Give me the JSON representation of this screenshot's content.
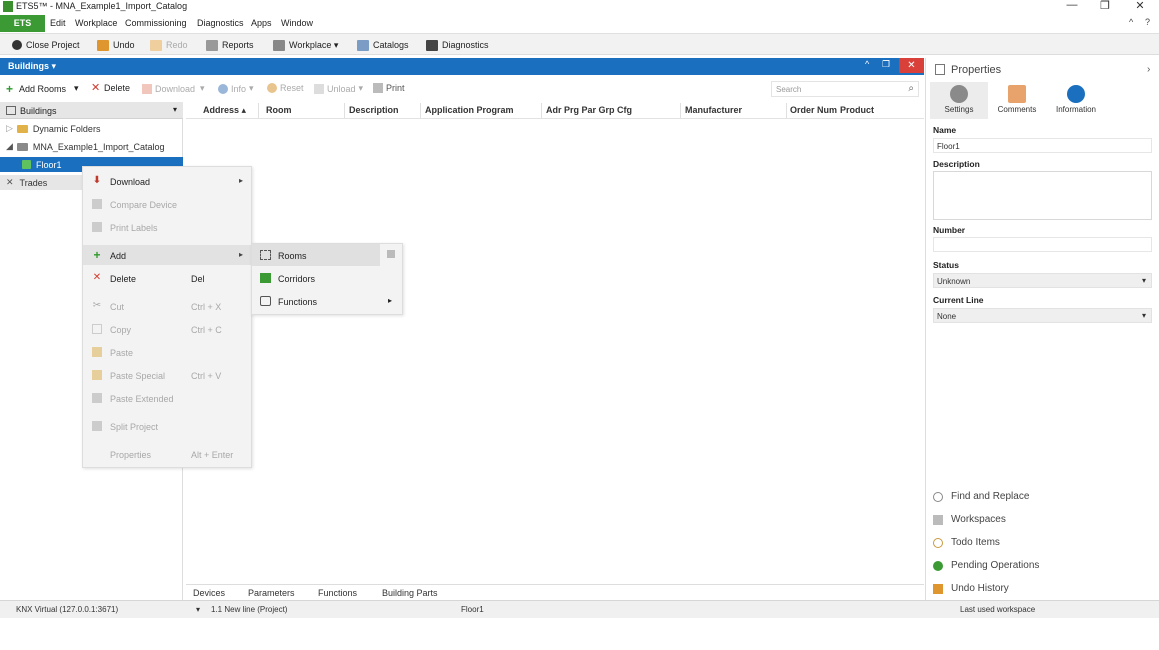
{
  "window": {
    "title": "ETS5™ - MNA_Example1_Import_Catalog",
    "controls": [
      "—",
      "❐",
      "✕"
    ]
  },
  "menubar": {
    "app_tab": "ETS",
    "items": [
      "Edit",
      "Workplace",
      "Commissioning",
      "Diagnostics",
      "Apps",
      "Window"
    ],
    "right": [
      "^",
      "?"
    ]
  },
  "toolbar": {
    "close_project": "Close Project",
    "undo": "Undo",
    "redo": "Redo",
    "reports": "Reports",
    "workplace": "Workplace ▾",
    "catalogs": "Catalogs",
    "diagnostics": "Diagnostics"
  },
  "panel": {
    "title": "Buildings ▾",
    "controls": [
      "^",
      "❐",
      "✕"
    ]
  },
  "toolbar2": {
    "add_rooms": "Add Rooms",
    "delete": "Delete",
    "download": "Download",
    "info": "Info",
    "reset": "Reset",
    "unload": "Unload",
    "print": "Print",
    "search_placeholder": "Search"
  },
  "tree": {
    "header": "Buildings",
    "dynamic_folders": "Dynamic Folders",
    "project": "MNA_Example1_Import_Catalog",
    "floor": "Floor1",
    "trades": "Trades"
  },
  "grid": {
    "columns": [
      "Address ▴",
      "Room",
      "Description",
      "Application Program",
      "Adr Prg Par Grp Cfg",
      "Manufacturer",
      "Order Num",
      "Product"
    ]
  },
  "context_menu": {
    "download": "Download",
    "compare_device": "Compare Device",
    "print_labels": "Print Labels",
    "add": "Add",
    "delete": "Delete",
    "delete_sc": "Del",
    "cut": "Cut",
    "cut_sc": "Ctrl + X",
    "copy": "Copy",
    "copy_sc": "Ctrl + C",
    "paste": "Paste",
    "paste_special": "Paste Special",
    "paste_special_sc": "Ctrl + V",
    "paste_extended": "Paste Extended",
    "split_project": "Split Project",
    "properties": "Properties",
    "properties_sc": "Alt + Enter"
  },
  "submenu": {
    "rooms": "Rooms",
    "corridors": "Corridors",
    "functions": "Functions"
  },
  "bottom_tabs": [
    "Devices",
    "Parameters",
    "Functions",
    "Building Parts"
  ],
  "properties": {
    "title": "Properties",
    "tabs": [
      "Settings",
      "Comments",
      "Information"
    ],
    "name_label": "Name",
    "name_value": "Floor1",
    "description_label": "Description",
    "number_label": "Number",
    "status_label": "Status",
    "status_value": "Unknown",
    "current_line_label": "Current Line",
    "current_line_value": "None",
    "links": [
      "Find and Replace",
      "Workspaces",
      "Todo Items",
      "Pending Operations",
      "Undo History"
    ]
  },
  "statusbar": {
    "connection": "KNX Virtual  (127.0.0.1:3671)",
    "line": "1.1 New line (Project)",
    "selection": "Floor1",
    "workspace": "Last used workspace"
  },
  "colors": {
    "accent_blue": "#1a6fbf",
    "ets_green": "#3c9a35",
    "close_red": "#d9403a"
  }
}
